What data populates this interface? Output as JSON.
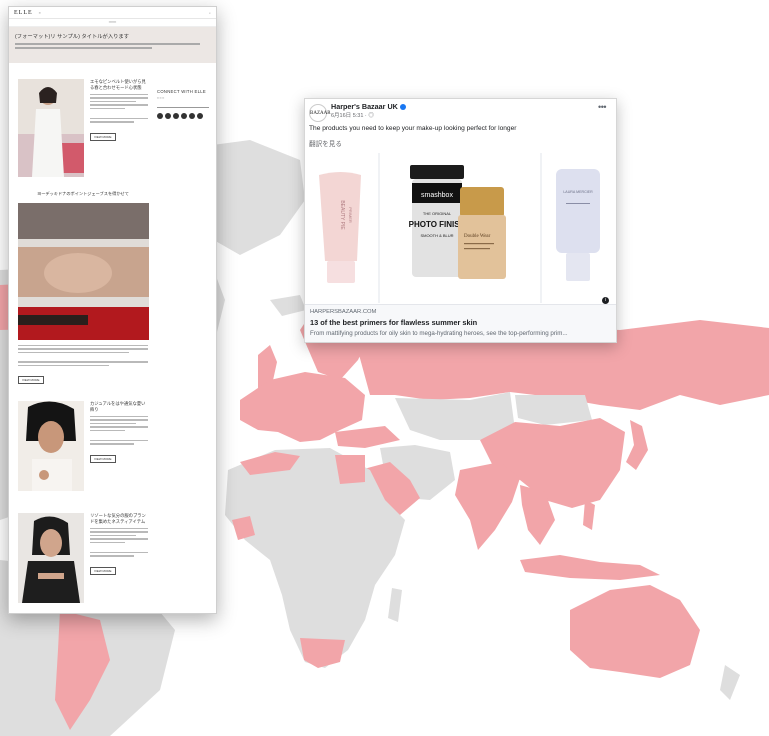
{
  "magazine": {
    "logo": "ELLE",
    "hero_title": "(フォーマット)リ サンプル) タイトルが入ります",
    "articles": [
      {
        "title": "エモなピンベルト使いがら見る春と合わせモード心状態",
        "button": "VIEW MORE"
      },
      {
        "title": "カジュアルをはや通気な夏い飾り",
        "button": "VIEW MORE"
      },
      {
        "title": "リゾートな気分の服のブランドを集めたネスティアイテム",
        "button": "VIEW MORE"
      }
    ],
    "section_title": "ヨーデッキドナのポイントジェーブスを得かせて",
    "feature_button": "VIEW MORE",
    "sidebar": {
      "heading": "CONNECT WITH ELLE"
    },
    "colors": {
      "background": "#ffffff",
      "hero": "#ece7e4"
    }
  },
  "facebook_ad": {
    "page_name": "Harper's Bazaar UK",
    "avatar_text": "BAZAAR",
    "timestamp": "6月16日 5:31 · ",
    "post_text": "The products you need to keep your make-up looking perfect for longer",
    "translate_link": "翻訳を見る",
    "products": [
      {
        "brand": "BEAUTY PIE",
        "name": "PRIMER"
      },
      {
        "brand": "smashbox",
        "name": "PHOTO FINISH",
        "tag": "THE ORIGINAL",
        "sub": "SMOOTH & BLUR"
      },
      {
        "brand": "",
        "name": "Double Wear"
      },
      {
        "brand": "LAURA MERCIER",
        "name": ""
      }
    ],
    "link_domain": "HARPERSBAZAAR.COM",
    "link_headline": "13 of the best primers for flawless summer skin",
    "link_description": "From mattifying products for oily skin to mega-hydrating heroes, see the top-performing prim...",
    "colors": {
      "verified": "#1877f2",
      "footer_bg": "#f7f8fa"
    }
  },
  "map": {
    "colors": {
      "land_default": "#dedede",
      "land_highlight": "#f2a5a9"
    },
    "highlighted_regions": [
      "Europe",
      "Russia",
      "China",
      "India",
      "Saudi Arabia",
      "Japan",
      "Southeast Asia",
      "Australia",
      "South Africa",
      "Argentina",
      "Turkey",
      "Egypt"
    ]
  }
}
